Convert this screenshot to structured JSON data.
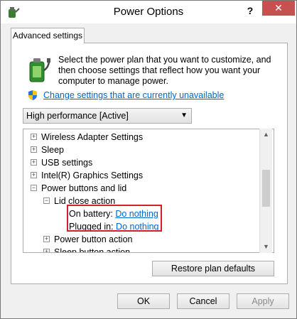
{
  "window": {
    "title": "Power Options",
    "help_label": "?",
    "close_label": "✕"
  },
  "tab": {
    "label": "Advanced settings"
  },
  "description": "Select the power plan that you want to customize, and then choose settings that reflect how you want your computer to manage power.",
  "change_link": "Change settings that are currently unavailable",
  "plan": {
    "selected": "High performance [Active]"
  },
  "tree": {
    "items": [
      {
        "expander": "+",
        "label": "Wireless Adapter Settings"
      },
      {
        "expander": "+",
        "label": "Sleep"
      },
      {
        "expander": "+",
        "label": "USB settings"
      },
      {
        "expander": "+",
        "label": "Intel(R) Graphics Settings"
      },
      {
        "expander": "−",
        "label": "Power buttons and lid"
      },
      {
        "expander": "−",
        "label": "Lid close action"
      },
      {
        "label": "On battery:",
        "value": "Do nothing"
      },
      {
        "label": "Plugged in:",
        "value": "Do nothing"
      },
      {
        "expander": "+",
        "label": "Power button action"
      },
      {
        "expander": "+",
        "label": "Sleep button action"
      }
    ]
  },
  "buttons": {
    "restore": "Restore plan defaults",
    "ok": "OK",
    "cancel": "Cancel",
    "apply": "Apply"
  },
  "colors": {
    "link": "#0066cc",
    "highlight_box": "#d0202a",
    "close_button": "#c75050"
  }
}
